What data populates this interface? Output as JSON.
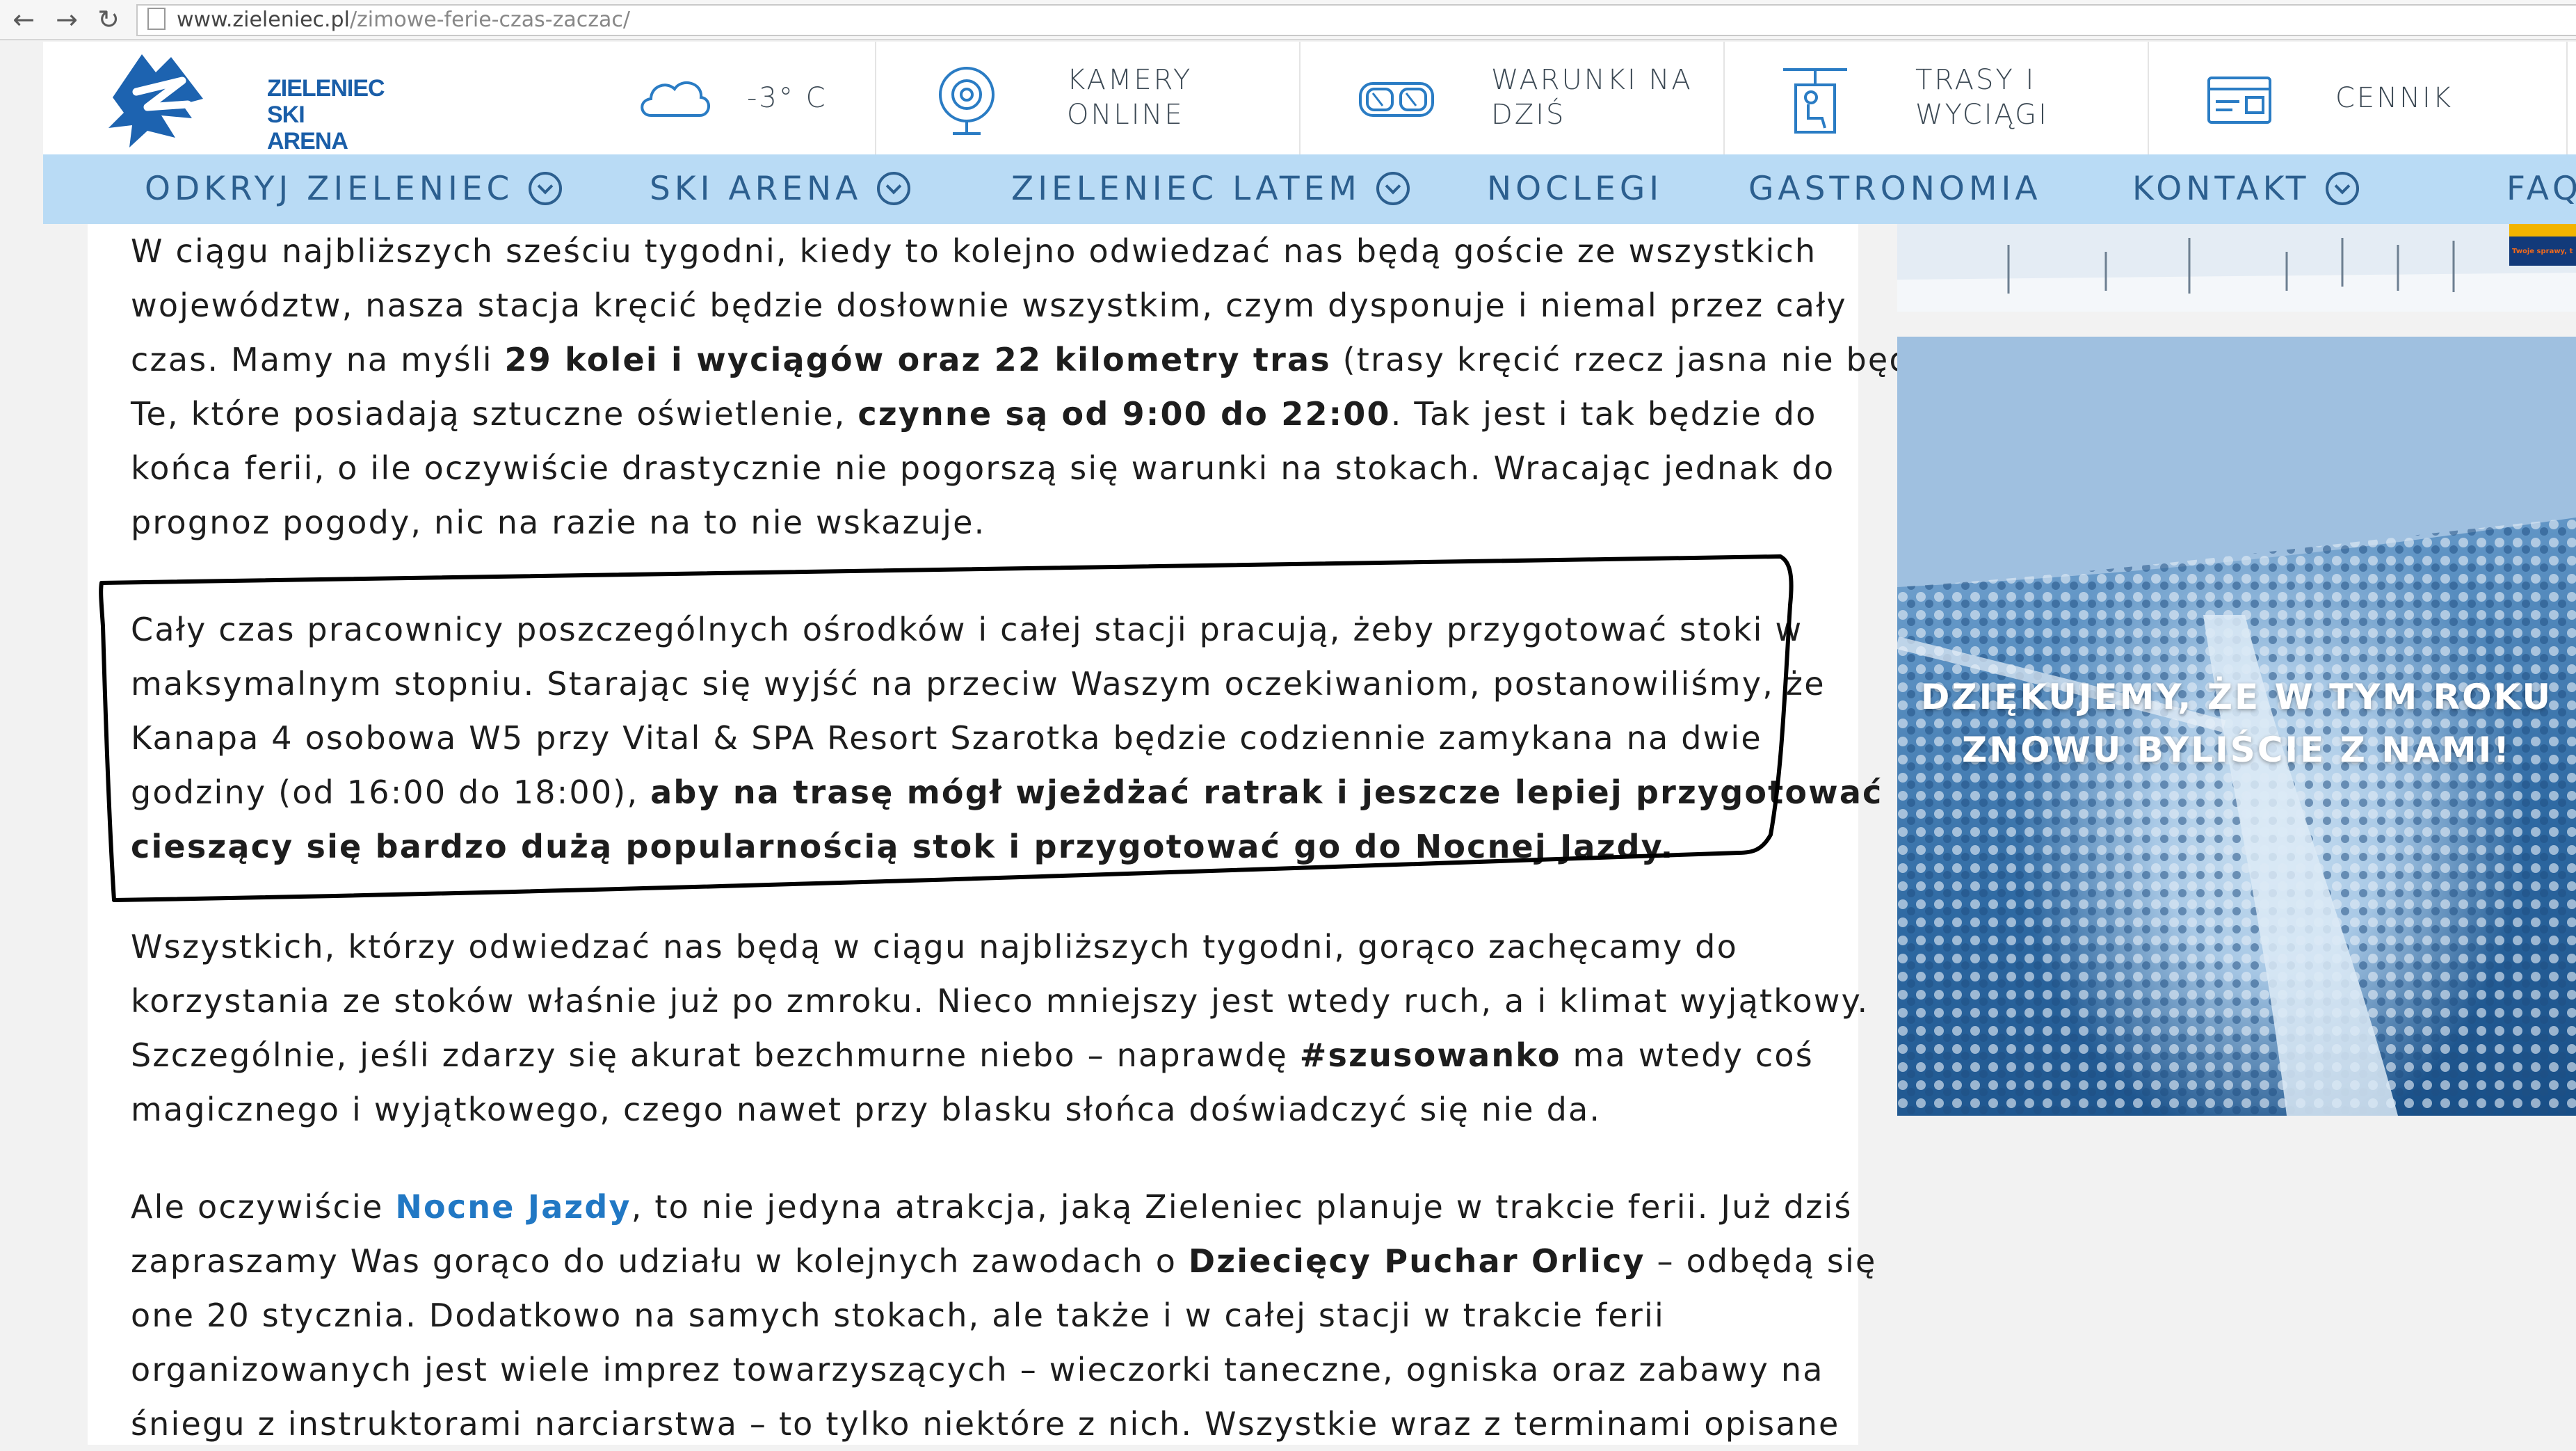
{
  "browser": {
    "url_host": "www.zieleniec.pl",
    "url_path": "/zimowe-ferie-czas-zaczac/"
  },
  "header": {
    "logo_line1": "ZIELENIEC",
    "logo_line2": "SKI ARENA",
    "weather_temp": "-3° C",
    "items": [
      {
        "line1": "KAMERY",
        "line2": "ONLINE",
        "icon": "webcam-icon"
      },
      {
        "line1": "WARUNKI NA",
        "line2": "DZIŚ",
        "icon": "ski-goggles-icon"
      },
      {
        "line1": "TRASY I",
        "line2": "WYCIĄGI",
        "icon": "ski-lift-icon"
      },
      {
        "line1": "CENNIK",
        "line2": "",
        "icon": "ticket-card-icon"
      }
    ]
  },
  "menu": [
    {
      "label": "ODKRYJ ZIELENIEC",
      "has_dropdown": true
    },
    {
      "label": "SKI ARENA",
      "has_dropdown": true
    },
    {
      "label": "ZIELENIEC LATEM",
      "has_dropdown": true
    },
    {
      "label": "NOCLEGI",
      "has_dropdown": false
    },
    {
      "label": "GASTRONOMIA",
      "has_dropdown": false
    },
    {
      "label": "KONTAKT",
      "has_dropdown": true
    },
    {
      "label": "FAQ",
      "has_dropdown": false
    }
  ],
  "article": {
    "p1": [
      "W ciągu najbliższych sześciu tygodni, kiedy to kolejno odwiedzać nas będą goście ze wszystkich",
      "województw, nasza stacja kręcić będzie dosłownie wszystkim, czym dysponuje i niemal przez cały",
      "czas. Mamy na myśli ",
      "29 kolei i wyciągów oraz 22 kilometry tras",
      " (trasy kręcić rzecz jasna nie będą).",
      "Te, które posiadają sztuczne oświetlenie, ",
      "czynne są od 9:00 do 22:00",
      ". Tak jest i tak będzie do",
      "końca ferii, o ile oczywiście drastycznie nie pogorszą się warunki na stokach. Wracając jednak do",
      "prognoz pogody, nic na razie na to nie wskazuje."
    ],
    "p2": [
      "Cały czas pracownicy poszczególnych ośrodków i całej stacji pracują, żeby przygotować stoki w",
      "maksymalnym stopniu. Starając się wyjść na przeciw Waszym oczekiwaniom, postanowiliśmy, że",
      "Kanapa 4 osobowa W5 przy Vital & SPA Resort Szarotka będzie codziennie zamykana na dwie",
      "godziny (od 16:00 do 18:00), ",
      "aby na trasę mógł wjeżdżać ratrak i jeszcze lepiej przygotować",
      "cieszący się bardzo dużą popularnością stok i przygotować go do Nocnej Jazdy."
    ],
    "p3": [
      "Wszystkich, którzy odwiedzać nas będą w ciągu najbliższych tygodni, gorąco zachęcamy do",
      "korzystania ze stoków właśnie już po zmroku. Nieco mniejszy jest wtedy ruch, a i klimat wyjątkowy.",
      "Szczególnie, jeśli zdarzy się akurat bezchmurne niebo – naprawdę ",
      "#szusowanko",
      " ma wtedy coś",
      "magicznego i wyjątkowego, czego nawet przy blasku słońca doświadczyć się nie da."
    ],
    "p4": [
      "Ale oczywiście ",
      "Nocne Jazdy",
      ", to nie jedyna atrakcja, jaką Zieleniec planuje w trakcie ferii. Już dziś",
      "zapraszamy Was gorąco do udziału w kolejnych zawodach o ",
      "Dziecięcy Puchar Orlicy",
      " – odbędą się",
      "one 20 stycznia. Dodatkowo na samych stokach, ale także i w całej stacji w trakcie ferii",
      "organizowanych jest wiele imprez towarzyszących – wieczorki taneczne, ogniska oraz zabawy na",
      "śniegu z instruktorami narciarstwa – to tylko niektóre z nich. Wszystkie wraz z terminami opisane"
    ]
  },
  "sidebar": {
    "caption_line1": "DZIĘKUJEMY, ŻE W TYM ROKU",
    "caption_line2": "ZNOWU BYLIŚCIE Z NAMI!",
    "top_banner_snippet": "Twoje sprawy, t"
  }
}
